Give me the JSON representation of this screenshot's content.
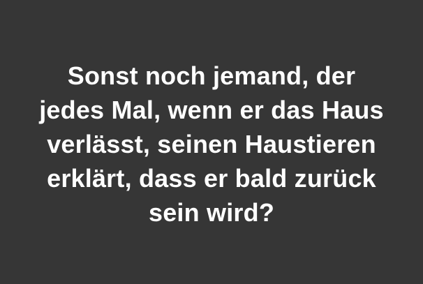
{
  "quote": {
    "lines": [
      "Sonst noch jemand, der",
      "jedes Mal, wenn er das Haus",
      "verlässt, seinen Haustieren",
      "erklärt, dass er bald zurück",
      "sein wird?"
    ]
  },
  "colors": {
    "background": "#363636",
    "text": "#ffffff"
  }
}
